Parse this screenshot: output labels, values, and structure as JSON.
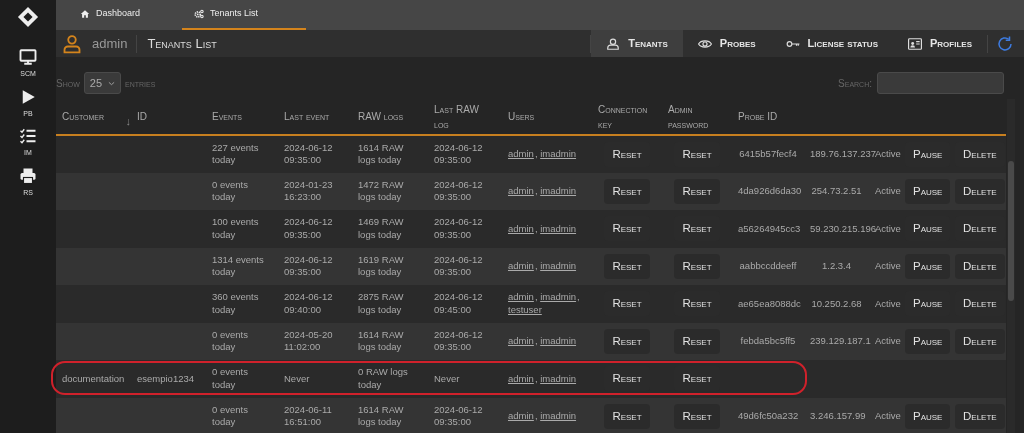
{
  "sidebar": {
    "items": [
      {
        "label": "SCM",
        "kind": "monitor"
      },
      {
        "label": "PB",
        "kind": "play"
      },
      {
        "label": "IM",
        "kind": "checklist"
      },
      {
        "label": "RS",
        "kind": "printer"
      }
    ]
  },
  "top_tabs": [
    {
      "label": "Dashboard",
      "kind": "home",
      "selected": false
    },
    {
      "label": "Tenants List",
      "kind": "gears",
      "selected": true
    }
  ],
  "header": {
    "user": "admin",
    "title": "Tenants List",
    "nav": [
      {
        "label": "Tenants",
        "kind": "person",
        "selected": true
      },
      {
        "label": "Probes",
        "kind": "eye",
        "selected": false
      },
      {
        "label": "License status",
        "kind": "key",
        "selected": false
      },
      {
        "label": "Profiles",
        "kind": "card",
        "selected": false
      }
    ]
  },
  "length_control": {
    "before": "Show",
    "value": "25",
    "after": "entries"
  },
  "search": {
    "label": "Search:"
  },
  "table": {
    "columns": [
      {
        "label": "Customer",
        "sort": "↓"
      },
      {
        "label": "ID"
      },
      {
        "label": "Events"
      },
      {
        "label": "Last event"
      },
      {
        "label": "RAW logs"
      },
      {
        "label": "Last RAW log"
      },
      {
        "label": "Users"
      },
      {
        "label": "Connection key"
      },
      {
        "label": "Admin password"
      },
      {
        "label": "Probe ID"
      }
    ],
    "rows": [
      {
        "events": "227 events today",
        "last_event": "2024-06-12 09:35:00",
        "raw_logs": "1614 RAW logs today",
        "last_raw_log": "2024-06-12 09:35:00",
        "users": [
          {
            "name": "admin",
            "sep": ","
          },
          {
            "name": "imadmin"
          }
        ],
        "connection_key_button": "Reset",
        "admin_password_button": "Reset",
        "probe_id": "6415b57fecf4",
        "column_11": "189.76.137.237",
        "column_12": "Active",
        "pause_button": "Pause",
        "delete_button": "Delete",
        "highlighted": false
      },
      {
        "events": "0 events today",
        "last_event": "2024-01-23 16:23:00",
        "raw_logs": "1472 RAW logs today",
        "last_raw_log": "2024-06-12 09:35:00",
        "users": [
          {
            "name": "admin",
            "sep": ","
          },
          {
            "name": "imadmin"
          }
        ],
        "connection_key_button": "Reset",
        "admin_password_button": "Reset",
        "probe_id": "4da926d6da30",
        "column_11": "254.73.2.51",
        "column_12": "Active",
        "pause_button": "Pause",
        "delete_button": "Delete",
        "highlighted": false
      },
      {
        "events": "100 events today",
        "last_event": "2024-06-12 09:35:00",
        "raw_logs": "1469 RAW logs today",
        "last_raw_log": "2024-06-12 09:35:00",
        "users": [
          {
            "name": "admin",
            "sep": ","
          },
          {
            "name": "imadmin"
          }
        ],
        "connection_key_button": "Reset",
        "admin_password_button": "Reset",
        "probe_id": "a56264945cc3",
        "column_11": "59.230.215.196",
        "column_12": "Active",
        "pause_button": "Pause",
        "delete_button": "Delete",
        "highlighted": false
      },
      {
        "events": "1314 events today",
        "last_event": "2024-06-12 09:35:00",
        "raw_logs": "1619 RAW logs today",
        "last_raw_log": "2024-06-12 09:35:00",
        "users": [
          {
            "name": "admin",
            "sep": ","
          },
          {
            "name": "imadmin"
          }
        ],
        "connection_key_button": "Reset",
        "admin_password_button": "Reset",
        "probe_id": "aabbccddeeff",
        "column_11": "1.2.3.4",
        "column_12": "Active",
        "pause_button": "Pause",
        "delete_button": "Delete",
        "highlighted": false
      },
      {
        "events": "360 events today",
        "last_event": "2024-06-12 09:40:00",
        "raw_logs": "2875 RAW logs today",
        "last_raw_log": "2024-06-12 09:45:00",
        "users": [
          {
            "name": "admin",
            "sep": ","
          },
          {
            "name": "imadmin",
            "sep": ","
          },
          {
            "name": "testuser"
          }
        ],
        "connection_key_button": "Reset",
        "admin_password_button": "Reset",
        "probe_id": "ae65ea8088dc",
        "column_11": "10.250.2.68",
        "column_12": "Active",
        "pause_button": "Pause",
        "delete_button": "Delete",
        "highlighted": false
      },
      {
        "events": "0 events today",
        "last_event": "2024-05-20 11:02:00",
        "raw_logs": "1614 RAW logs today",
        "last_raw_log": "2024-06-12 09:35:00",
        "users": [
          {
            "name": "admin",
            "sep": ","
          },
          {
            "name": "imadmin"
          }
        ],
        "connection_key_button": "Reset",
        "admin_password_button": "Reset",
        "probe_id": "febda5bc5ff5",
        "column_11": "239.129.187.1",
        "column_12": "Active",
        "pause_button": "Pause",
        "delete_button": "Delete",
        "highlighted": false
      },
      {
        "customer": "documentation",
        "id": "esempio1234",
        "events": "0 events today",
        "last_event": "Never",
        "raw_logs": "0 RAW logs today",
        "last_raw_log": "Never",
        "users": [
          {
            "name": "admin",
            "sep": ","
          },
          {
            "name": "imadmin"
          }
        ],
        "connection_key_button": "Reset",
        "admin_password_button": "Reset",
        "highlighted": true
      },
      {
        "events": "0 events today",
        "last_event": "2024-06-11 16:51:00",
        "raw_logs": "1614 RAW logs today",
        "last_raw_log": "2024-06-12 09:35:00",
        "users": [
          {
            "name": "admin",
            "sep": ","
          },
          {
            "name": "imadmin"
          }
        ],
        "connection_key_button": "Reset",
        "admin_password_button": "Reset",
        "probe_id": "49d6fc50a232",
        "column_11": "3.246.157.99",
        "column_12": "Active",
        "pause_button": "Pause",
        "delete_button": "Delete",
        "highlighted": false
      }
    ]
  }
}
